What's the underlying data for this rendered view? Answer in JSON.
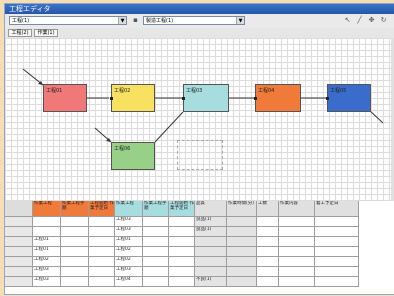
{
  "window": {
    "title": "工程エディタ"
  },
  "toolbar": {
    "select_left": "工程(1)",
    "select_right": "製造工程(1)",
    "icons": [
      "cursor-icon",
      "line-icon",
      "move-icon",
      "refresh-icon"
    ]
  },
  "tabs": [
    {
      "label": "工程(2)"
    },
    {
      "label": "作業(1)"
    }
  ],
  "canvas": {
    "nodes": [
      {
        "label": "工程01",
        "color": "#f07878"
      },
      {
        "label": "工程02",
        "color": "#f8e060"
      },
      {
        "label": "工程03",
        "color": "#a8dde0"
      },
      {
        "label": "工程04",
        "color": "#f07a3a"
      },
      {
        "label": "工程05",
        "color": "#3a6ccc"
      },
      {
        "label": "工程06",
        "color": "#98d088"
      }
    ]
  },
  "grid": {
    "headers": [
      {
        "label": "作業工程",
        "color": "#f07a3a"
      },
      {
        "label": "作業工程手順",
        "color": "#f07a3a"
      },
      {
        "label": "工程開始 作業予定日",
        "color": "#f07a3a"
      },
      {
        "label": "作業工程",
        "color": "#a8dde0"
      },
      {
        "label": "作業工程手順",
        "color": "#a8dde0"
      },
      {
        "label": "工程開始 作業予定日",
        "color": "#a8dde0"
      },
      {
        "label": "品質",
        "color": "#e0e0e0"
      },
      {
        "label": "作業時間(分)",
        "color": "#e0e0e0"
      },
      {
        "label": "工数",
        "color": "#e0e0e0"
      },
      {
        "label": "作業内容",
        "color": "#e0e0e0"
      },
      {
        "label": "着工予定日",
        "color": "#e0e0e0"
      }
    ],
    "rows": [
      [
        "",
        "",
        "",
        "工程03",
        "",
        "",
        "良品(1)",
        "",
        "",
        "",
        ""
      ],
      [
        "",
        "",
        "",
        "工程03",
        "",
        "",
        "良品(1)",
        "",
        "",
        "",
        ""
      ],
      [
        "工程01",
        "",
        "",
        "工程01",
        "",
        "",
        "",
        "",
        "",
        "",
        ""
      ],
      [
        "工程01",
        "",
        "",
        "工程02",
        "",
        "",
        "",
        "",
        "",
        "",
        ""
      ],
      [
        "工程02",
        "",
        "",
        "工程02",
        "",
        "",
        "",
        "",
        "",
        "",
        ""
      ],
      [
        "工程03",
        "",
        "",
        "工程03",
        "",
        "",
        "",
        "",
        "",
        "",
        ""
      ],
      [
        "工程03",
        "",
        "",
        "工程04",
        "",
        "",
        "不良(1)",
        "",
        "",
        "",
        ""
      ]
    ]
  }
}
